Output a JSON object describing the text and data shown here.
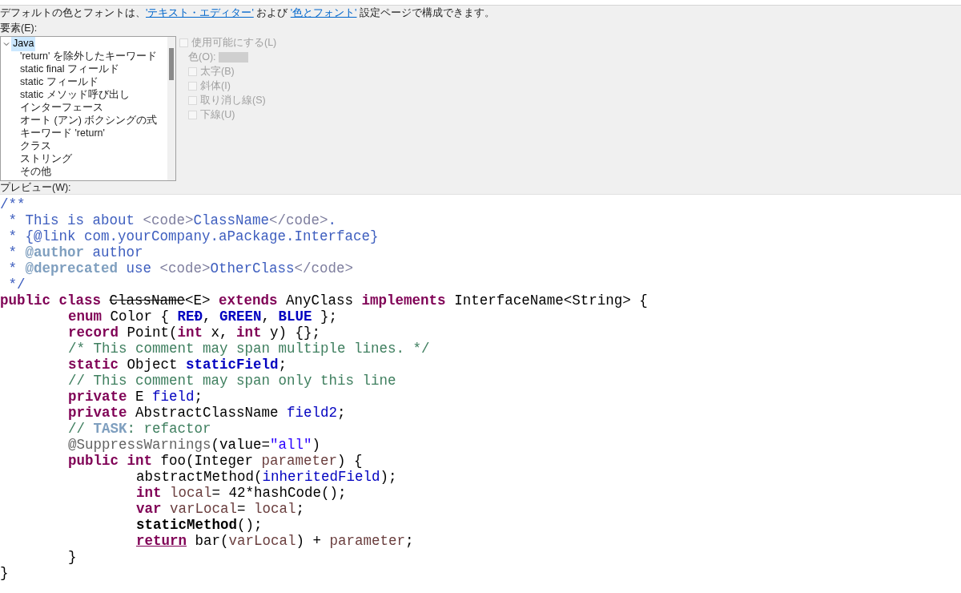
{
  "intro": {
    "before": "デフォルトの色とフォントは、",
    "link1": "'テキスト・エディター'",
    "middle": " および ",
    "link2": "'色とフォント'",
    "after": " 設定ページで構成できます。"
  },
  "elements_label": "要素(E):",
  "tree": [
    {
      "label": "Java",
      "expanded": true,
      "selected": true,
      "children": [
        {
          "label": "'return' を除外したキーワード",
          "selected": false
        },
        {
          "label": "static final フィールド",
          "selected": false
        },
        {
          "label": "static フィールド",
          "selected": false
        },
        {
          "label": "static メソッド呼び出し",
          "selected": false
        },
        {
          "label": "インターフェース",
          "selected": false
        },
        {
          "label": "オート (アン) ボクシングの式",
          "selected": false
        },
        {
          "label": "キーワード 'return'",
          "selected": false
        },
        {
          "label": "クラス",
          "selected": false
        },
        {
          "label": "ストリング",
          "selected": false
        },
        {
          "label": "その他",
          "selected": false
        }
      ]
    }
  ],
  "options": [
    {
      "kind": "checkbox",
      "label": "使用可能にする(L)",
      "checked": false,
      "disabled": true
    },
    {
      "kind": "color",
      "label": "色(O):",
      "disabled": true
    },
    {
      "kind": "checkbox",
      "label": "太字(B)",
      "checked": false,
      "disabled": true
    },
    {
      "kind": "checkbox",
      "label": "斜体(I)",
      "checked": false,
      "disabled": true
    },
    {
      "kind": "checkbox",
      "label": "取り消し線(S)",
      "checked": false,
      "disabled": true
    },
    {
      "kind": "checkbox",
      "label": "下線(U)",
      "checked": false,
      "disabled": true
    }
  ],
  "preview_label": "プレビュー(W):",
  "code": [
    {
      "tokens": [
        {
          "kind": "javadoc",
          "text": "/**"
        }
      ]
    },
    {
      "tokens": [
        {
          "kind": "javadoc",
          "text": " * This is about "
        },
        {
          "kind": "html",
          "text": "<code>"
        },
        {
          "kind": "javadoc",
          "text": "ClassName"
        },
        {
          "kind": "html",
          "text": "</code>"
        },
        {
          "kind": "javadoc",
          "text": "."
        }
      ]
    },
    {
      "tokens": [
        {
          "kind": "javadoc",
          "text": " * {@link com.yourCompany.aPackage.Interface}"
        }
      ]
    },
    {
      "tokens": [
        {
          "kind": "javadoc",
          "text": " * "
        },
        {
          "kind": "tag",
          "text": "@author"
        },
        {
          "kind": "javadoc",
          "text": " author"
        }
      ]
    },
    {
      "tokens": [
        {
          "kind": "javadoc",
          "text": " * "
        },
        {
          "kind": "tag",
          "text": "@deprecated"
        },
        {
          "kind": "javadoc",
          "text": " use "
        },
        {
          "kind": "html",
          "text": "<code>"
        },
        {
          "kind": "javadoc",
          "text": "OtherClass"
        },
        {
          "kind": "html",
          "text": "</code>"
        }
      ]
    },
    {
      "tokens": [
        {
          "kind": "javadoc",
          "text": " */"
        }
      ]
    },
    {
      "tokens": [
        {
          "kind": "keyword",
          "text": "public class "
        },
        {
          "kind": "deprecated",
          "text": "ClassName"
        },
        {
          "kind": "plain",
          "text": "<E> "
        },
        {
          "kind": "keyword",
          "text": "extends"
        },
        {
          "kind": "plain",
          "text": " AnyClass "
        },
        {
          "kind": "keyword",
          "text": "implements"
        },
        {
          "kind": "plain",
          "text": " InterfaceName<String> {"
        }
      ],
      "children": [
        {
          "tokens": [
            {
              "kind": "keyword",
              "text": "enum"
            },
            {
              "kind": "plain",
              "text": " Color { "
            },
            {
              "kind": "enum",
              "text": "REĐ"
            },
            {
              "kind": "plain",
              "text": ", "
            },
            {
              "kind": "enum",
              "text": "GREEN"
            },
            {
              "kind": "plain",
              "text": ", "
            },
            {
              "kind": "enum",
              "text": "BLUE"
            },
            {
              "kind": "plain",
              "text": " };"
            }
          ]
        },
        {
          "tokens": [
            {
              "kind": "keyword",
              "text": "record"
            },
            {
              "kind": "plain",
              "text": " Point("
            },
            {
              "kind": "keyword",
              "text": "int"
            },
            {
              "kind": "plain",
              "text": " x, "
            },
            {
              "kind": "keyword",
              "text": "int"
            },
            {
              "kind": "plain",
              "text": " y) {};"
            }
          ]
        },
        {
          "tokens": [
            {
              "kind": "comment",
              "text": "/* This comment may span multiple lines. */"
            }
          ]
        },
        {
          "tokens": [
            {
              "kind": "keyword",
              "text": "static"
            },
            {
              "kind": "plain",
              "text": " Object "
            },
            {
              "kind": "static_field",
              "text": "staticField"
            },
            {
              "kind": "plain",
              "text": ";"
            }
          ]
        },
        {
          "tokens": [
            {
              "kind": "comment",
              "text": "// This comment may span only this line"
            }
          ]
        },
        {
          "tokens": [
            {
              "kind": "keyword",
              "text": "private"
            },
            {
              "kind": "plain",
              "text": " E "
            },
            {
              "kind": "field",
              "text": "field"
            },
            {
              "kind": "plain",
              "text": ";"
            }
          ]
        },
        {
          "tokens": [
            {
              "kind": "keyword",
              "text": "private"
            },
            {
              "kind": "plain",
              "text": " AbstractClassName "
            },
            {
              "kind": "field",
              "text": "field2"
            },
            {
              "kind": "plain",
              "text": ";"
            }
          ]
        },
        {
          "tokens": [
            {
              "kind": "comment",
              "text": "// "
            },
            {
              "kind": "task",
              "text": "TASK"
            },
            {
              "kind": "comment",
              "text": ": refactor"
            }
          ]
        },
        {
          "tokens": [
            {
              "kind": "annotation",
              "text": "@SuppressWarnings"
            },
            {
              "kind": "plain",
              "text": "(value="
            },
            {
              "kind": "string",
              "text": "\"all\""
            },
            {
              "kind": "plain",
              "text": ")"
            }
          ]
        },
        {
          "tokens": [
            {
              "kind": "keyword",
              "text": "public int"
            },
            {
              "kind": "plain",
              "text": " foo(Integer "
            },
            {
              "kind": "local",
              "text": "parameter"
            },
            {
              "kind": "plain",
              "text": ") {"
            }
          ],
          "children": [
            {
              "tokens": [
                {
                  "kind": "plain",
                  "text": "abstractMethod("
                },
                {
                  "kind": "field",
                  "text": "inheritedField"
                },
                {
                  "kind": "plain",
                  "text": ");"
                }
              ]
            },
            {
              "tokens": [
                {
                  "kind": "keyword",
                  "text": "int "
                },
                {
                  "kind": "local",
                  "text": "local"
                },
                {
                  "kind": "plain",
                  "text": "= 42*hashCode();"
                }
              ]
            },
            {
              "tokens": [
                {
                  "kind": "keyword",
                  "text": "var "
                },
                {
                  "kind": "local",
                  "text": "varLocal"
                },
                {
                  "kind": "plain",
                  "text": "= "
                },
                {
                  "kind": "local",
                  "text": "local"
                },
                {
                  "kind": "plain",
                  "text": ";"
                }
              ]
            },
            {
              "tokens": [
                {
                  "kind": "static_method",
                  "text": "staticMethod"
                },
                {
                  "kind": "plain",
                  "text": "();"
                }
              ]
            },
            {
              "tokens": [
                {
                  "kind": "return",
                  "text": "return"
                },
                {
                  "kind": "plain",
                  "text": " bar("
                },
                {
                  "kind": "local",
                  "text": "varLocal"
                },
                {
                  "kind": "plain",
                  "text": ") + "
                },
                {
                  "kind": "local",
                  "text": "parameter"
                },
                {
                  "kind": "plain",
                  "text": ";"
                }
              ]
            }
          ]
        },
        {
          "tokens": [
            {
              "kind": "plain",
              "text": "}"
            }
          ]
        }
      ]
    },
    {
      "tokens": [
        {
          "kind": "plain",
          "text": "}"
        }
      ]
    }
  ]
}
